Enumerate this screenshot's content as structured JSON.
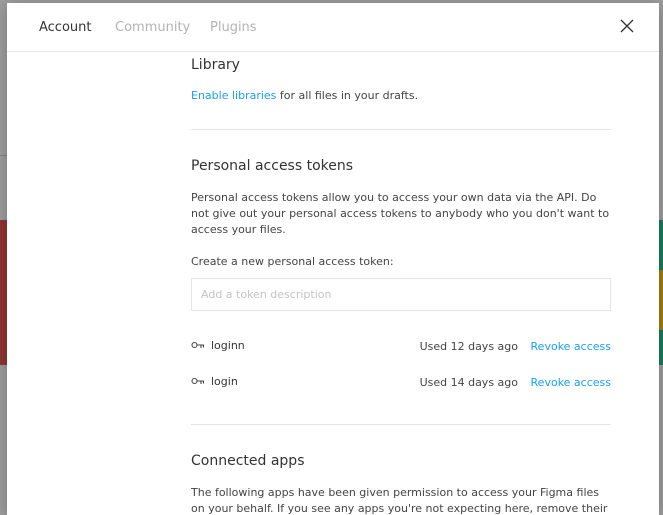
{
  "tabs": [
    {
      "label": "Account"
    },
    {
      "label": "Community"
    },
    {
      "label": "Plugins"
    }
  ],
  "library": {
    "title": "Library",
    "link": "Enable libraries",
    "text": " for all files in your drafts."
  },
  "tokens": {
    "title": "Personal access tokens",
    "description": "Personal access tokens allow you to access your own data via the API. Do not give out your personal access tokens to anybody who you don't want to access your files.",
    "create_label": "Create a new personal access token:",
    "input_placeholder": "Add a token description",
    "items": [
      {
        "name": "loginn",
        "used": "Used 12 days ago",
        "revoke": "Revoke access"
      },
      {
        "name": "login",
        "used": "Used 14 days ago",
        "revoke": "Revoke access"
      }
    ]
  },
  "connected_apps": {
    "title": "Connected apps",
    "description": "The following apps have been given permission to access your Figma files on your behalf. If you see any apps you're not expecting here, remove their"
  },
  "colors": {
    "link": "#18a0fb",
    "text": "#333333",
    "inactive_tab": "#b3b3b3",
    "divider": "#e5e5e5"
  }
}
